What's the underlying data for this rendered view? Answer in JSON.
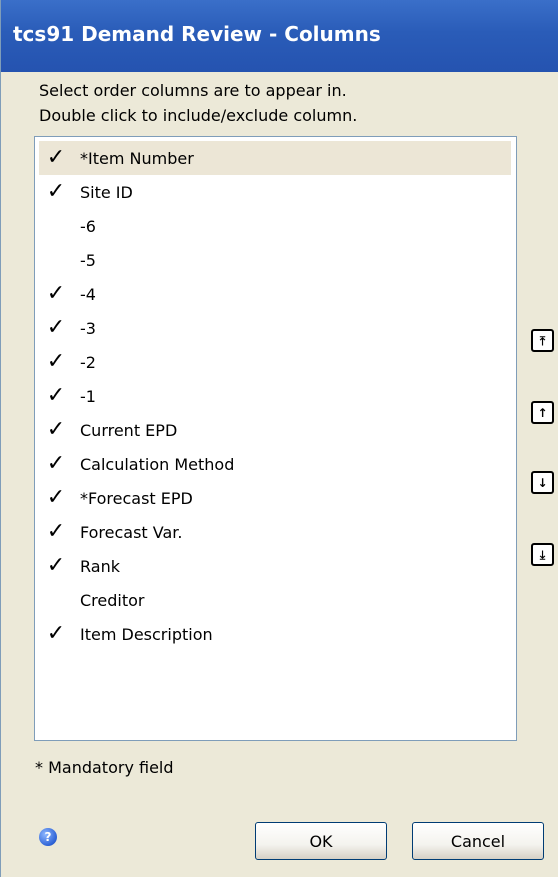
{
  "window": {
    "title": "tcs91 Demand Review - Columns"
  },
  "instructions": [
    "Select order columns are to appear in.",
    "Double click to include/exclude column."
  ],
  "columns": [
    {
      "label": "*Item Number",
      "checked": true,
      "selected": true
    },
    {
      "label": "Site ID",
      "checked": true
    },
    {
      "label": "-6",
      "checked": false
    },
    {
      "label": "-5",
      "checked": false
    },
    {
      "label": "-4",
      "checked": true
    },
    {
      "label": "-3",
      "checked": true
    },
    {
      "label": "-2",
      "checked": true
    },
    {
      "label": "-1",
      "checked": true
    },
    {
      "label": "Current EPD",
      "checked": true
    },
    {
      "label": "Calculation Method",
      "checked": true
    },
    {
      "label": "*Forecast EPD",
      "checked": true
    },
    {
      "label": "Forecast Var.",
      "checked": true
    },
    {
      "label": "Rank",
      "checked": true
    },
    {
      "label": "Creditor",
      "checked": false
    },
    {
      "label": "Item Description",
      "checked": true
    }
  ],
  "check_glyph": "✓",
  "side_buttons": {
    "move_top_glyph": "⤒",
    "move_up_glyph": "↑",
    "move_down_glyph": "↓",
    "move_bottom_glyph": "⤓"
  },
  "footnote": "* Mandatory field",
  "help_glyph": "?",
  "buttons": {
    "ok": "OK",
    "cancel": "Cancel"
  },
  "colors": {
    "titlebar": "#2a5cb8",
    "dialog_bg": "#ece9d8",
    "selected_row": "#ece6d6"
  }
}
